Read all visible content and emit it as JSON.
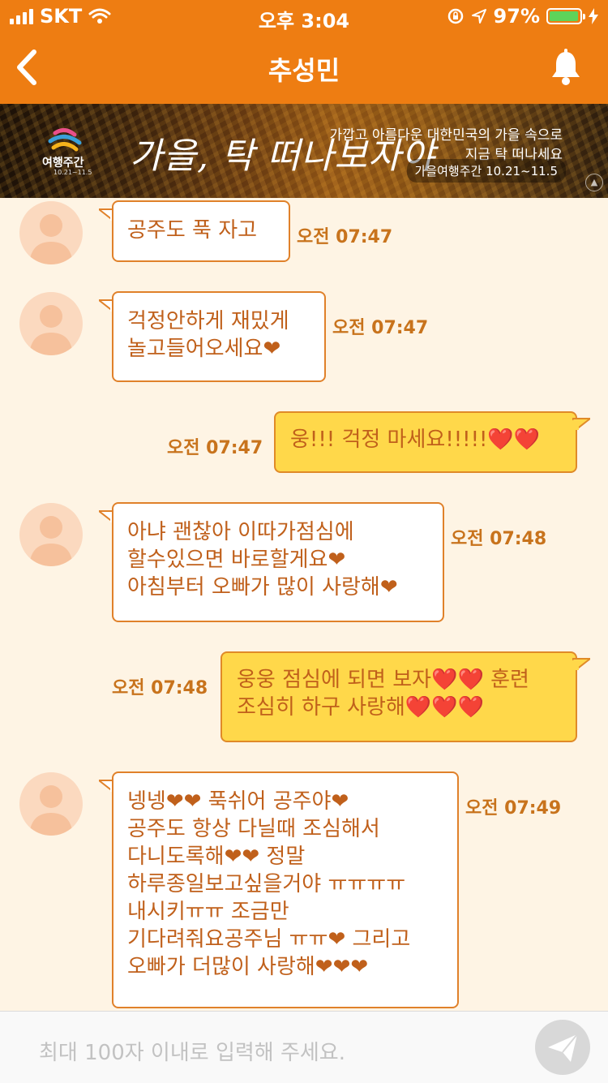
{
  "status_bar": {
    "carrier": "SKT",
    "time": "오후 3:04",
    "battery": "97%",
    "battery_level": 0.97
  },
  "header": {
    "title": "추성민",
    "back_icon": "chevron-left-icon",
    "bell_icon": "bell-icon",
    "accent_color": "#ee7d12"
  },
  "banner": {
    "logo_text": "여행주간",
    "logo_date": "10.21~11.5",
    "slogan": "가을, 탁 떠나보자야",
    "line1": "가깝고 아름다운 대한민국의 가을 속으로",
    "line2": "지금 탁 떠나세요",
    "pill": "가을여행주간 10.21~11.5"
  },
  "messages": [
    {
      "side": "in",
      "text": "공주도 푹 자고",
      "time": "오전 07:47"
    },
    {
      "side": "in",
      "text": "걱정안하게 재밌게\n놀고들어오세요❤",
      "time": "오전 07:47"
    },
    {
      "side": "out",
      "text": "웅!!! 걱정 마세요!!!!!❤️❤️",
      "time": "오전 07:47"
    },
    {
      "side": "in",
      "text": "아냐 괜찮아 이따가점심에\n할수있으면 바로할게요❤\n아침부터 오빠가 많이 사랑해❤",
      "time": "오전 07:48"
    },
    {
      "side": "out",
      "text": "웅웅 점심에 되면 보자❤️❤️ 훈련\n조심히 하구 사랑해❤️❤️❤️",
      "time": "오전 07:48"
    },
    {
      "side": "in",
      "text": "넹넹❤❤ 푹쉬어 공주야❤\n공주도 항상 다닐때 조심해서\n다니도록해❤❤ 정말\n하루종일보고싶을거야 ㅠㅠㅠㅠ\n내시키ㅠㅠ 조금만\n기다려줘요공주님 ㅠㅠ❤ 그리고\n오빠가 더많이 사랑해❤❤❤",
      "time": "오전 07:49"
    }
  ],
  "input": {
    "placeholder": "최대 100자 이내로 입력해 주세요.",
    "send_icon": "paper-plane-icon"
  }
}
